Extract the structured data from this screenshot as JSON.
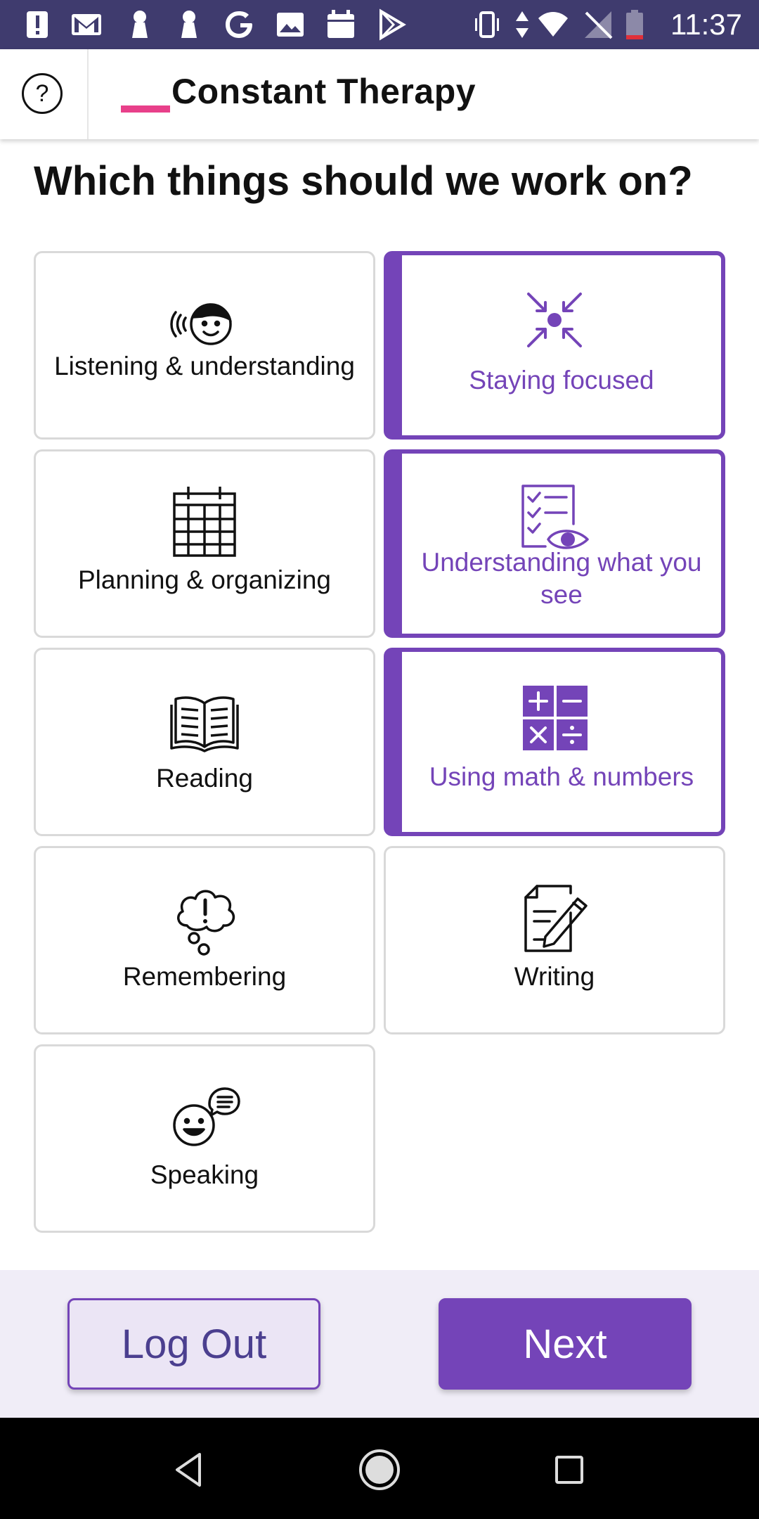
{
  "status_bar": {
    "time": "11:37",
    "left_icons": [
      "alert-icon",
      "gmail-icon",
      "keyhole-icon",
      "keyhole-icon",
      "google-icon",
      "image-icon",
      "calendar-icon",
      "play-store-icon"
    ],
    "right_icons": [
      "vibrate-icon",
      "data-arrows-icon",
      "wifi-icon",
      "no-signal-icon",
      "battery-low-icon"
    ],
    "background_color": "#3f3b6e"
  },
  "header": {
    "help_symbol": "?",
    "brand_name": "Constant Therapy",
    "brand_accent_color": "#e8408a"
  },
  "question": "Which things should we work on?",
  "categories": [
    {
      "label": "Listening & understanding",
      "icon": "listening-face-icon",
      "selected": false
    },
    {
      "label": "Staying focused",
      "icon": "focus-arrows-icon",
      "selected": true
    },
    {
      "label": "Planning & organizing",
      "icon": "calendar-grid-icon",
      "selected": false
    },
    {
      "label": "Understanding what you see",
      "icon": "checklist-eye-icon",
      "selected": true
    },
    {
      "label": "Reading",
      "icon": "open-book-icon",
      "selected": false
    },
    {
      "label": "Using math & numbers",
      "icon": "math-operators-icon",
      "selected": true
    },
    {
      "label": "Remembering",
      "icon": "thought-bubble-icon",
      "selected": false
    },
    {
      "label": "Writing",
      "icon": "pencil-paper-icon",
      "selected": false
    },
    {
      "label": "Speaking",
      "icon": "speaking-face-icon",
      "selected": false
    }
  ],
  "actions": {
    "logout_label": "Log Out",
    "next_label": "Next"
  },
  "colors": {
    "accent": "#7444b8",
    "action_bar_bg": "#f0edf7"
  }
}
